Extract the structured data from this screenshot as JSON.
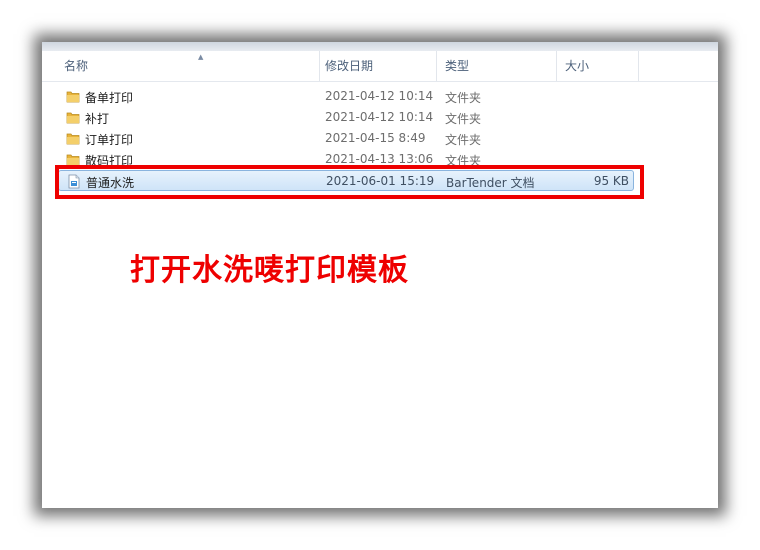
{
  "header": {
    "columns": {
      "name": "名称",
      "date": "修改日期",
      "type": "类型",
      "size": "大小"
    }
  },
  "files": [
    {
      "name": "备单打印",
      "date": "2021-04-12 10:14",
      "type": "文件夹",
      "size": "",
      "icon": "folder-icon"
    },
    {
      "name": "补打",
      "date": "2021-04-12 10:14",
      "type": "文件夹",
      "size": "",
      "icon": "folder-icon"
    },
    {
      "name": "订单打印",
      "date": "2021-04-15 8:49",
      "type": "文件夹",
      "size": "",
      "icon": "folder-icon"
    },
    {
      "name": "散码打印",
      "date": "2021-04-13 13:06",
      "type": "文件夹",
      "size": "",
      "icon": "folder-icon"
    },
    {
      "name": "普通水洗",
      "date": "2021-06-01 15:19",
      "type": "BarTender 文档",
      "size": "95 KB",
      "icon": "bartender-document-icon",
      "selected": true
    }
  ],
  "annotation": {
    "caption": "打开水洗唛打印模板",
    "color": "#ee0000"
  },
  "colors": {
    "selection": "#cfe4f8",
    "header_text": "#4c607a",
    "folder": "#e8b33a"
  }
}
